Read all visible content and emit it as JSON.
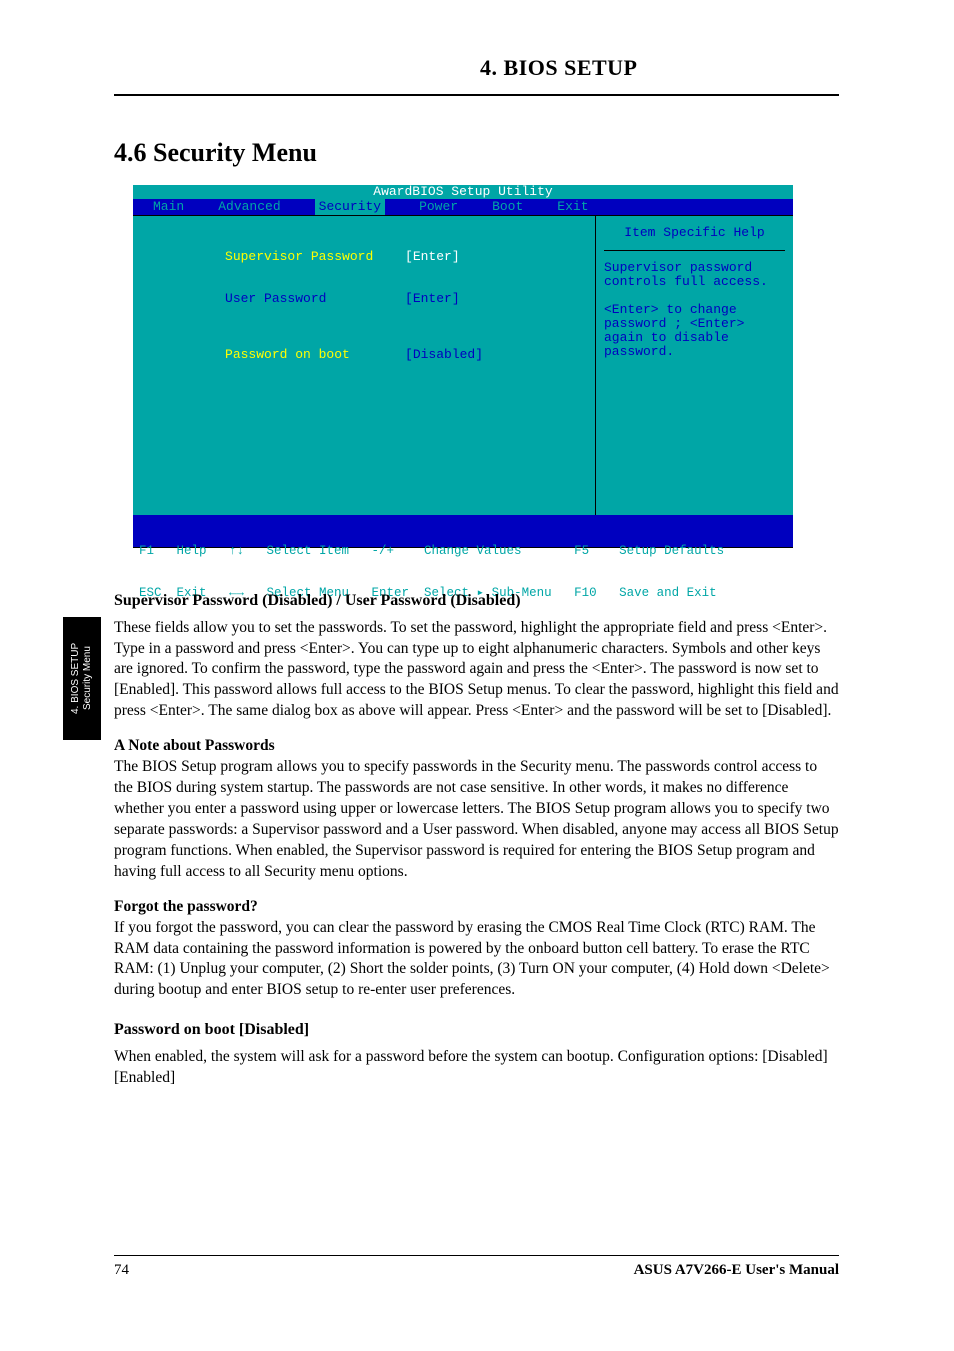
{
  "header": {
    "section_heading": "4. BIOS SETUP",
    "section_title": "4.6 Security Menu"
  },
  "bios": {
    "title": "AwardBIOS Setup Utility",
    "menu": [
      "Main",
      "Advanced",
      "Security",
      "Power",
      "Boot",
      "Exit"
    ],
    "active_menu": "Security",
    "rows": [
      {
        "label": "Supervisor Password",
        "value": "[Enter]",
        "highlight": true
      },
      {
        "label": "User Password",
        "value": "[Enter]",
        "dim": true
      },
      {
        "label": "",
        "value": ""
      },
      {
        "label": "Password on boot",
        "value": "[Disabled]",
        "dim_label": false,
        "dim_value": false,
        "yellow_label": true
      }
    ],
    "help_title": "Item Specific Help",
    "help_body": "Supervisor password controls full access.\n\n<Enter> to change password ; <Enter> again to disable password.",
    "footer_line1": "F1   Help   ↑↓   Select Item   -/+    Change Values       F5    Setup Defaults",
    "footer_line2": "ESC  Exit   ←→   Select Menu   Enter  Select ▸ Sub-Menu   F10   Save and Exit"
  },
  "sidetab": {
    "line1": "4. BIOS SETUP",
    "line2": "Security Menu"
  },
  "content": {
    "h1": "Supervisor Password (Disabled) / User Password (Disabled)",
    "p1": "These fields allow you to set the passwords. To set the password, highlight the appropriate field and press <Enter>. Type in a password and press <Enter>. You can type up to eight alphanumeric characters. Symbols and other keys are ignored. To confirm the password, type the password again and press the <Enter>. The password is now set to [Enabled]. This password allows full access to the BIOS Setup menus. To clear the password, highlight this field and press <Enter>. The same dialog box as above will appear. Press <Enter> and the password will be set to [Disabled].",
    "note_label": "A Note about Passwords",
    "note_body": "The BIOS Setup program allows you to specify passwords in the Security menu. The passwords control access to the BIOS during system startup. The passwords are not case sensitive. In other words, it makes no difference whether you enter a password using upper or lowercase letters. The BIOS Setup program allows you to specify two separate passwords: a Supervisor password and a User password. When disabled, anyone may access all BIOS Setup program functions. When enabled, the Supervisor password is required for entering the BIOS Setup program and having full access to all Security menu options.",
    "forgot_label": "Forgot the password?",
    "forgot_body": "If you forgot the password, you can clear the password by erasing the CMOS Real Time Clock (RTC) RAM. The RAM data containing the password information is powered by the onboard button cell battery. To erase the RTC RAM: (1) Unplug your computer, (2) Short the solder points, (3) Turn ON your computer, (4) Hold down <Delete> during bootup and enter BIOS setup to re-enter user preferences.",
    "h2": "Password on boot [Disabled]",
    "p2": "When enabled, the system will ask for a password before the system can bootup. Configuration options: [Disabled] [Enabled]"
  },
  "footer": {
    "page": "74",
    "product": "ASUS A7V266-E User's Manual"
  }
}
